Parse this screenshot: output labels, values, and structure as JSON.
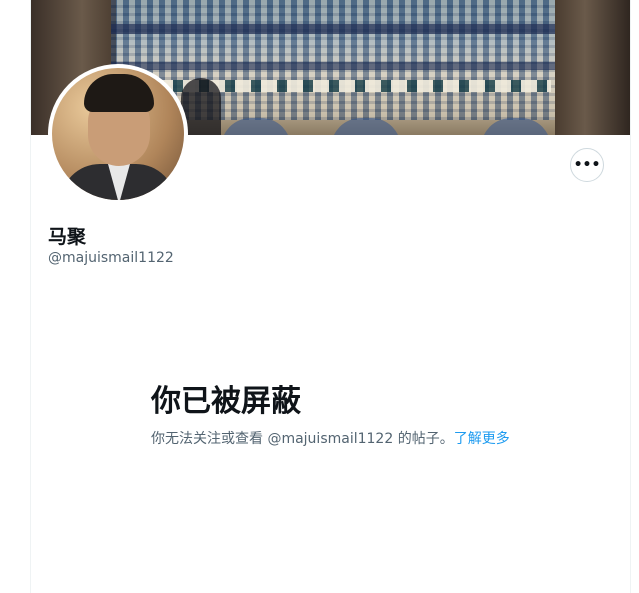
{
  "profile": {
    "display_name": "马聚",
    "handle": "@majuismail1122",
    "avatar_icon": "user-avatar",
    "banner_icon": "mosque-banner"
  },
  "actions": {
    "more_label": "•••"
  },
  "blocked_notice": {
    "title": "你已被屏蔽",
    "description": "你无法关注或查看 @majuismail1122 的帖子。",
    "learn_more": "了解更多"
  },
  "colors": {
    "text_primary": "#0f1419",
    "text_secondary": "#536471",
    "link": "#1d9bf0",
    "border": "#cfd9de"
  }
}
